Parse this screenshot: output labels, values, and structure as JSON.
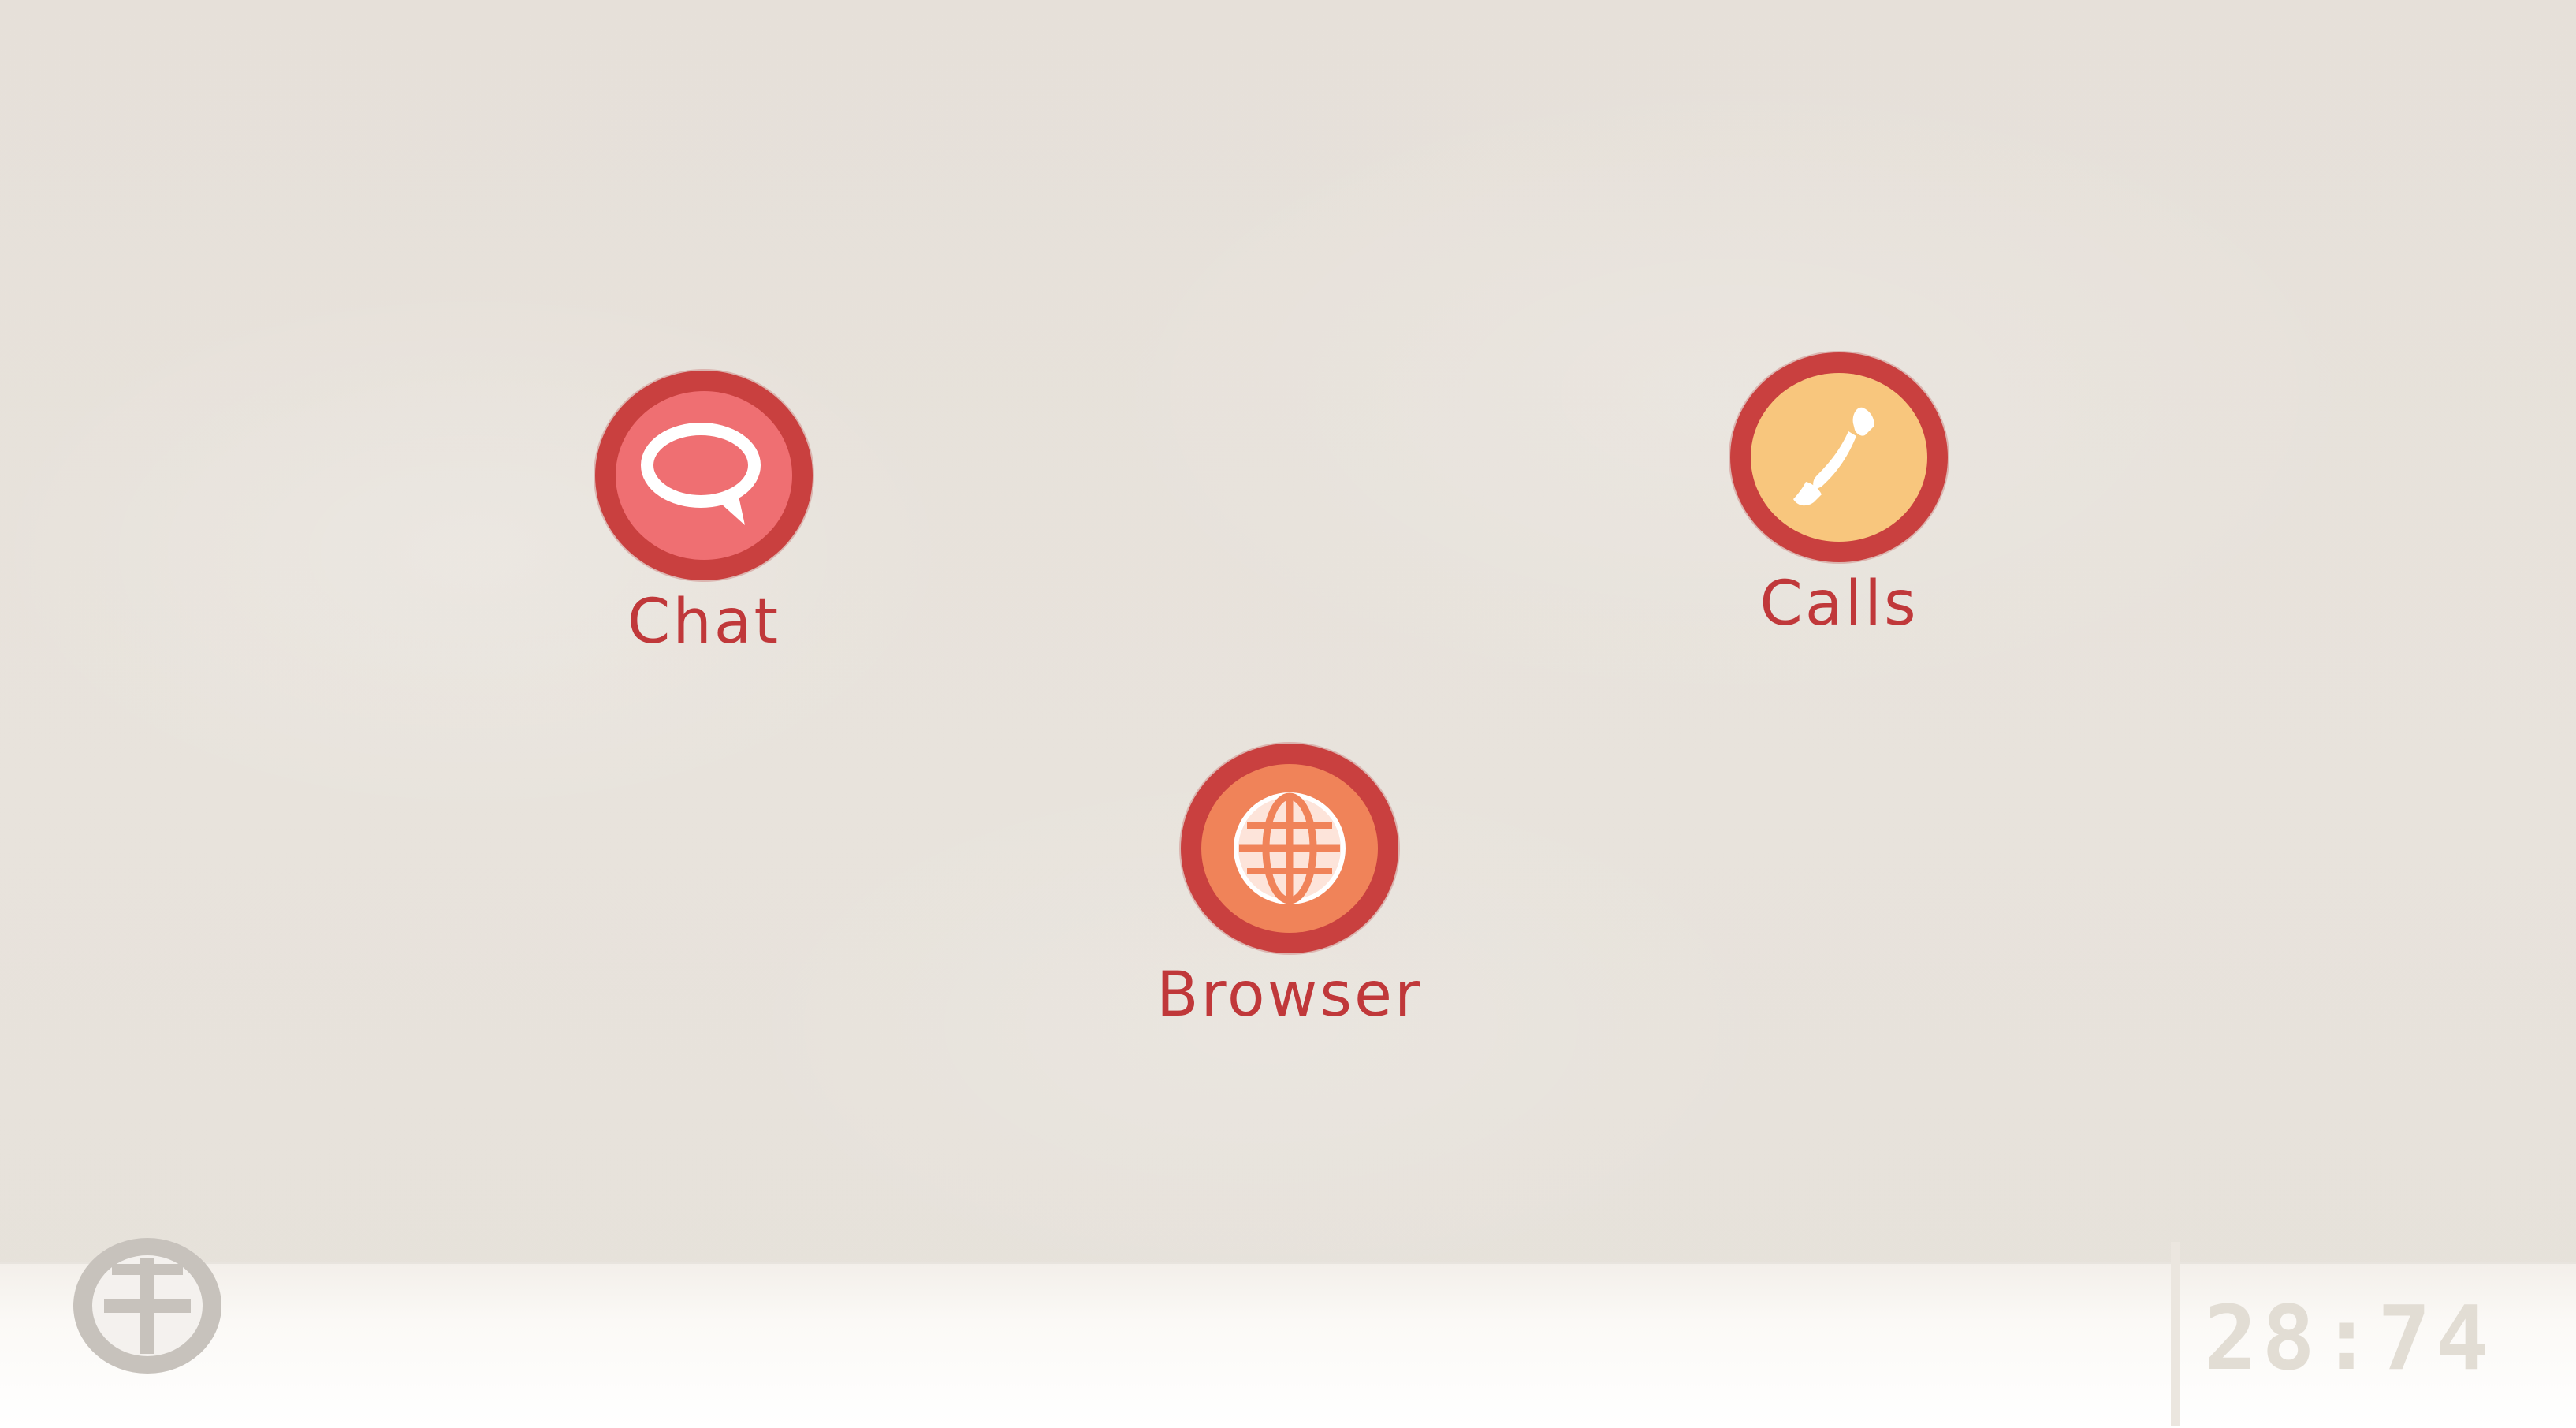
{
  "desktop": {
    "icons": [
      {
        "id": "chat",
        "label": "Chat",
        "color": "#ef6f72",
        "icon": "chat-bubble-icon"
      },
      {
        "id": "calls",
        "label": "Calls",
        "color": "#f8c67d",
        "icon": "phone-icon"
      },
      {
        "id": "browser",
        "label": "Browser",
        "color": "#f08359",
        "icon": "globe-icon"
      }
    ]
  },
  "taskbar": {
    "start_icon": "grid-icon",
    "clock": "28:74"
  },
  "colors": {
    "ring": "#c9403f",
    "label": "#c0383a",
    "background": "#e6e0d9",
    "taskbar": "#fbf9f6"
  }
}
